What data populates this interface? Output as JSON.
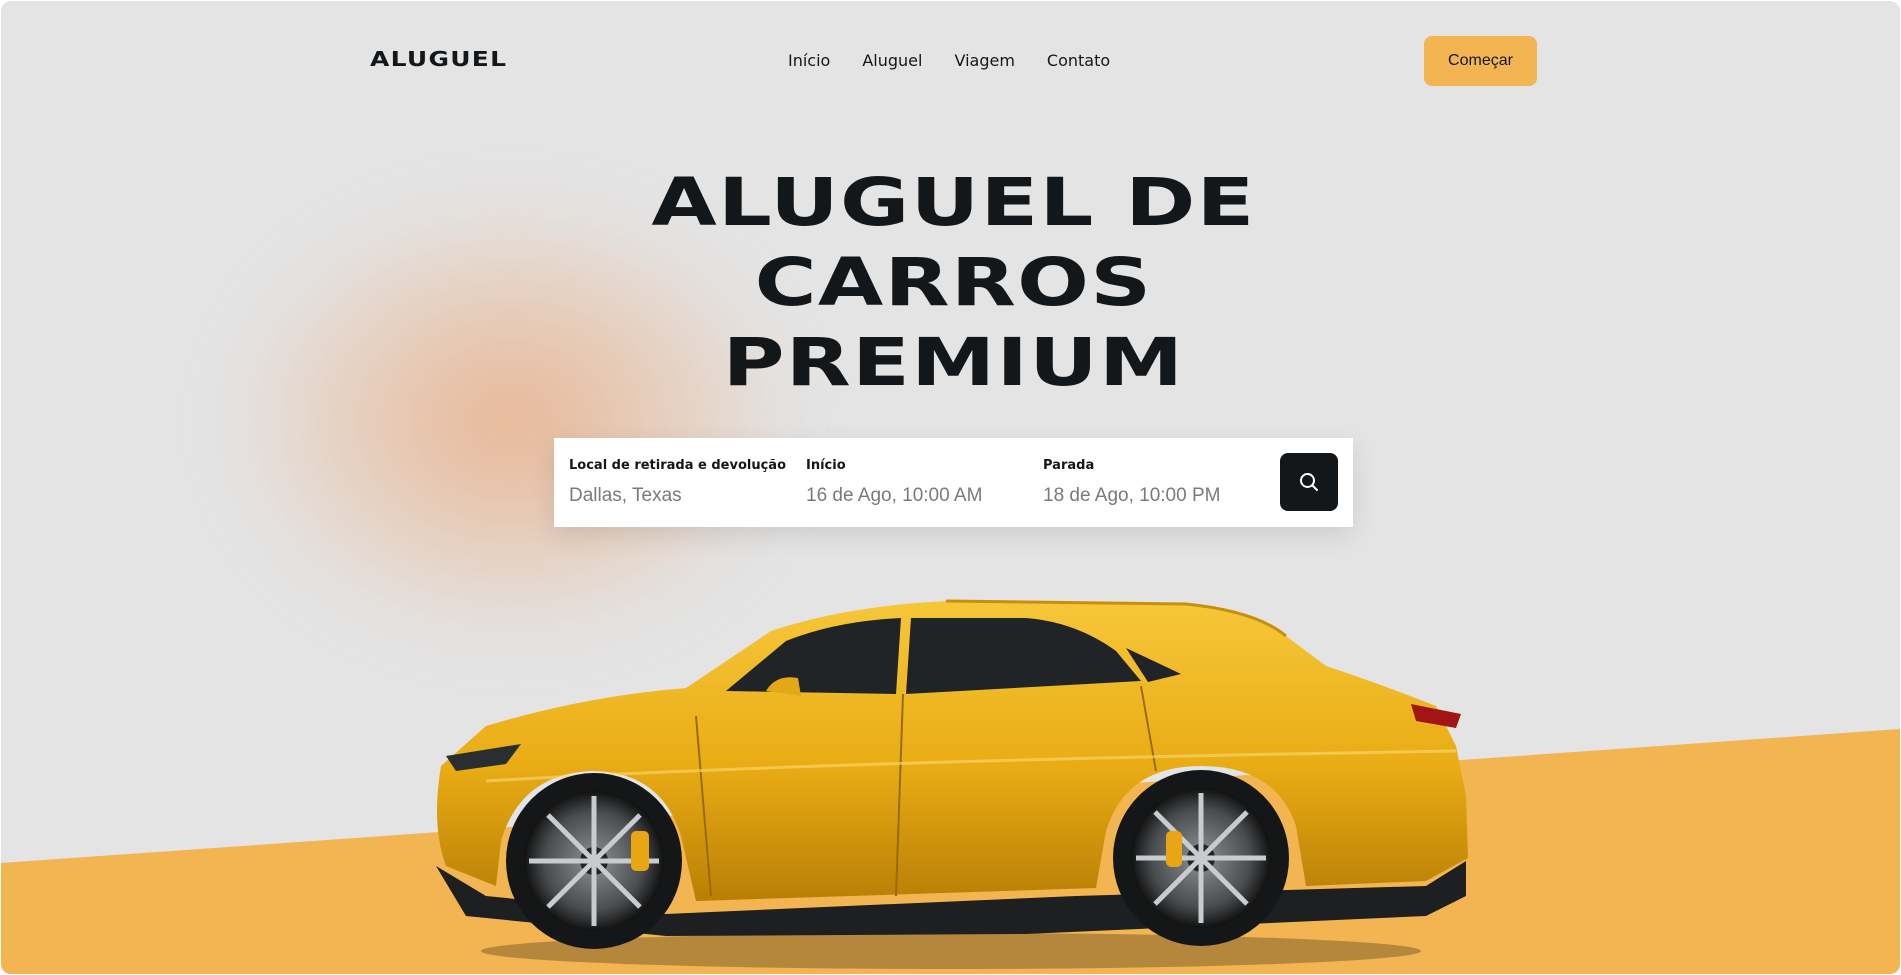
{
  "brand": {
    "logo": "ALUGUEL"
  },
  "nav": {
    "items": [
      "Início",
      "Aluguel",
      "Viagem",
      "Contato"
    ]
  },
  "header": {
    "cta_label": "Começar"
  },
  "hero": {
    "title_lines": [
      "ALUGUEL DE",
      "CARROS",
      "PREMIUM"
    ]
  },
  "search": {
    "fields": [
      {
        "label": "Local de retirada e devolução",
        "value": "Dallas, Texas"
      },
      {
        "label": "Início",
        "value": "16 de Ago, 10:00 AM"
      },
      {
        "label": "Parada",
        "value": "18 de Ago, 10:00 PM"
      }
    ],
    "button_icon": "search-icon"
  },
  "colors": {
    "accent": "#f2b552",
    "dark": "#14171a",
    "background": "#e4e4e4",
    "car_body": "#f0b41c"
  }
}
